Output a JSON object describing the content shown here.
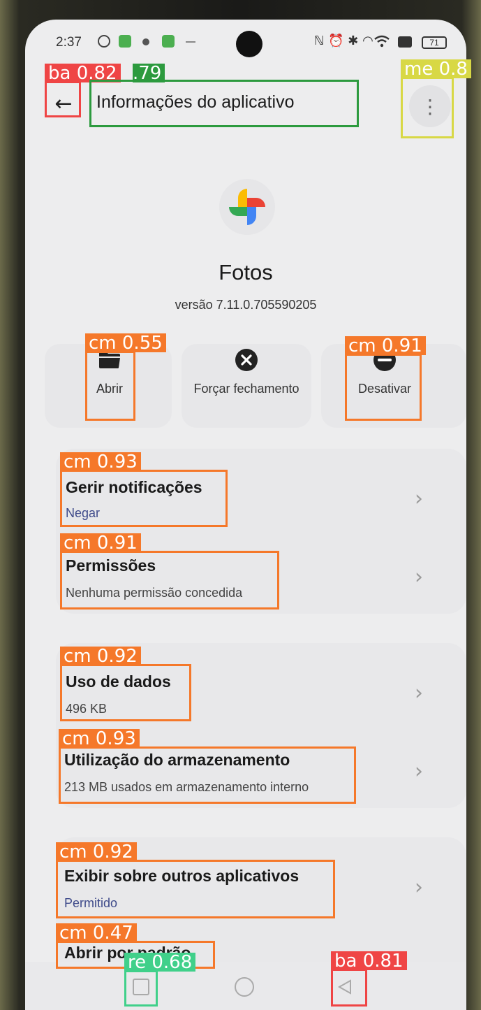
{
  "status_bar": {
    "time": "2:37",
    "right_icons": "ℕ ⏰ ✱ ◠",
    "battery": "71"
  },
  "app_bar": {
    "title": "Informações do aplicativo",
    "back_icon": "arrow-left-icon",
    "menu_icon": "more-vertical-icon"
  },
  "app": {
    "name": "Fotos",
    "version": "versão 7.11.0.705590205"
  },
  "actions": [
    {
      "label": "Abrir",
      "icon": "folder-icon"
    },
    {
      "label": "Forçar fechamento",
      "icon": "close-circle-icon"
    },
    {
      "label": "Desativar",
      "icon": "minus-circle-icon"
    }
  ],
  "settings": [
    {
      "title": "Gerir notificações",
      "subtitle": "Negar"
    },
    {
      "title": "Permissões",
      "subtitle": "Nenhuma permissão concedida"
    },
    {
      "title": "Uso de dados",
      "subtitle": "496 KB"
    },
    {
      "title": "Utilização do armazenamento",
      "subtitle": "213 MB usados em armazenamento interno"
    },
    {
      "title": "Exibir sobre outros aplicativos",
      "subtitle": "Permitido"
    },
    {
      "title": "Abrir por padrão",
      "subtitle": ""
    }
  ],
  "detections": [
    {
      "label": "ba 0.82",
      "color": "#ef4545"
    },
    {
      "label": ".79",
      "color": "#2c9a3e"
    },
    {
      "label": "me 0.8",
      "color": "#d8d845"
    },
    {
      "label": "cm 0.55",
      "color": "#f5782a"
    },
    {
      "label": "cm 0.91",
      "color": "#f5782a"
    },
    {
      "label": "cm 0.93",
      "color": "#f5782a"
    },
    {
      "label": "cm 0.91",
      "color": "#f5782a"
    },
    {
      "label": "cm 0.92",
      "color": "#f5782a"
    },
    {
      "label": "cm 0.93",
      "color": "#f5782a"
    },
    {
      "label": "cm 0.92",
      "color": "#f5782a"
    },
    {
      "label": "cm 0.47",
      "color": "#f5782a"
    },
    {
      "label": "re 0.68",
      "color": "#40d08a"
    },
    {
      "label": "ba 0.81",
      "color": "#ef4545"
    }
  ]
}
